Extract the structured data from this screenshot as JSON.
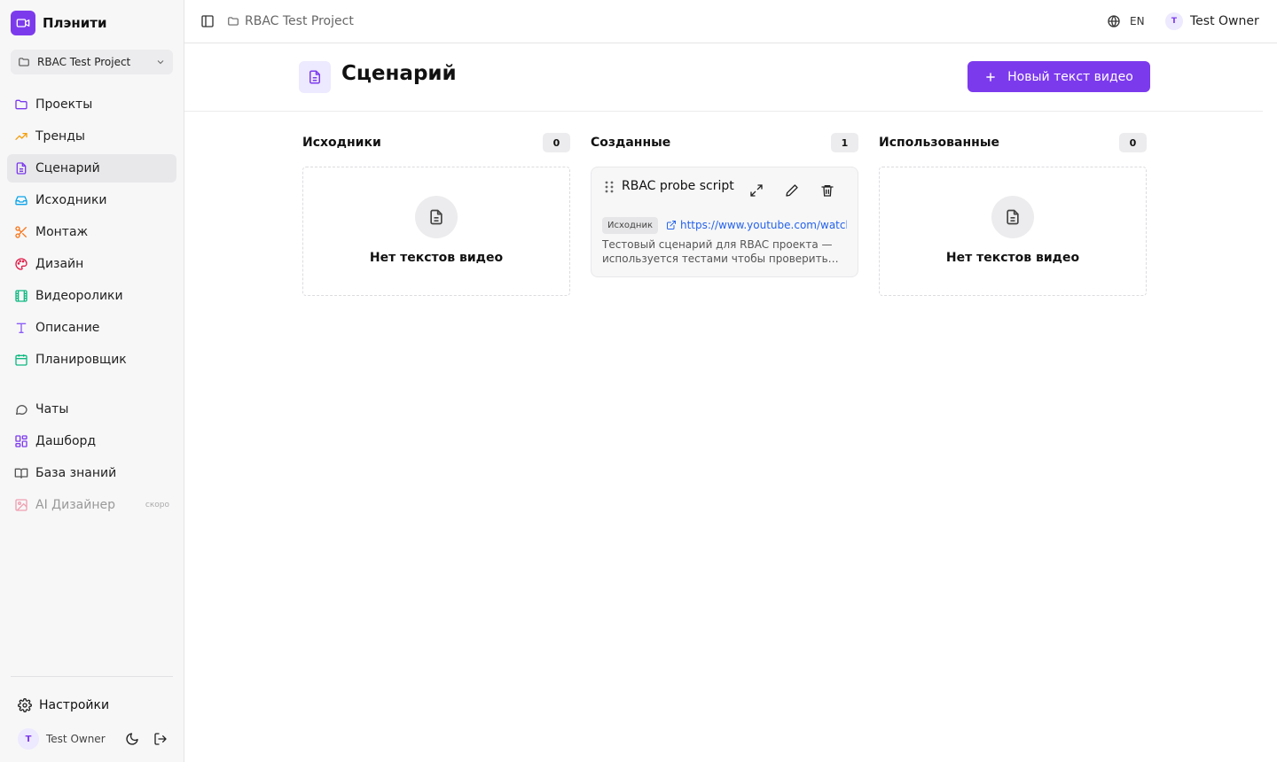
{
  "app": {
    "brand_name": "Плэнити",
    "accent": "#7c3aed"
  },
  "sidebar": {
    "project_select": "RBAC Test Project",
    "items": [
      {
        "label": "Проекты",
        "icon": "folder-icon"
      },
      {
        "label": "Тренды",
        "icon": "trending-icon"
      },
      {
        "label": "Сценарий",
        "icon": "document-icon",
        "active": true
      },
      {
        "label": "Исходники",
        "icon": "inbox-icon"
      },
      {
        "label": "Монтаж",
        "icon": "scissors-icon"
      },
      {
        "label": "Дизайн",
        "icon": "palette-icon"
      },
      {
        "label": "Видеоролики",
        "icon": "film-icon"
      },
      {
        "label": "Описание",
        "icon": "text-icon"
      },
      {
        "label": "Планировщик",
        "icon": "calendar-icon"
      }
    ],
    "items2": [
      {
        "label": "Чаты",
        "icon": "chat-icon"
      },
      {
        "label": "Дашборд",
        "icon": "dashboard-icon"
      },
      {
        "label": "База знаний",
        "icon": "book-icon"
      },
      {
        "label": "AI Дизайнер",
        "icon": "image-icon",
        "badge": "скоро"
      }
    ],
    "settings_label": "Настройки",
    "user_name": "Test Owner",
    "user_initial": "T"
  },
  "topbar": {
    "breadcrumb": "RBAC Test Project",
    "lang": "EN",
    "user_name": "Test Owner",
    "user_initial": "T"
  },
  "header": {
    "title": "Сценарий",
    "new_button": "Новый текст видео"
  },
  "board": {
    "columns": [
      {
        "title": "Исходники",
        "count": "0",
        "empty_text": "Нет текстов видео"
      },
      {
        "title": "Созданные",
        "count": "1",
        "card": {
          "title": "RBAC probe script",
          "tag": "Исходник",
          "link": "https://www.youtube.com/watch",
          "description": "Тестовый сценарий для RBAC проекта — используется тестами чтобы проверить…"
        }
      },
      {
        "title": "Использованные",
        "count": "0",
        "empty_text": "Нет текстов видео"
      }
    ]
  }
}
